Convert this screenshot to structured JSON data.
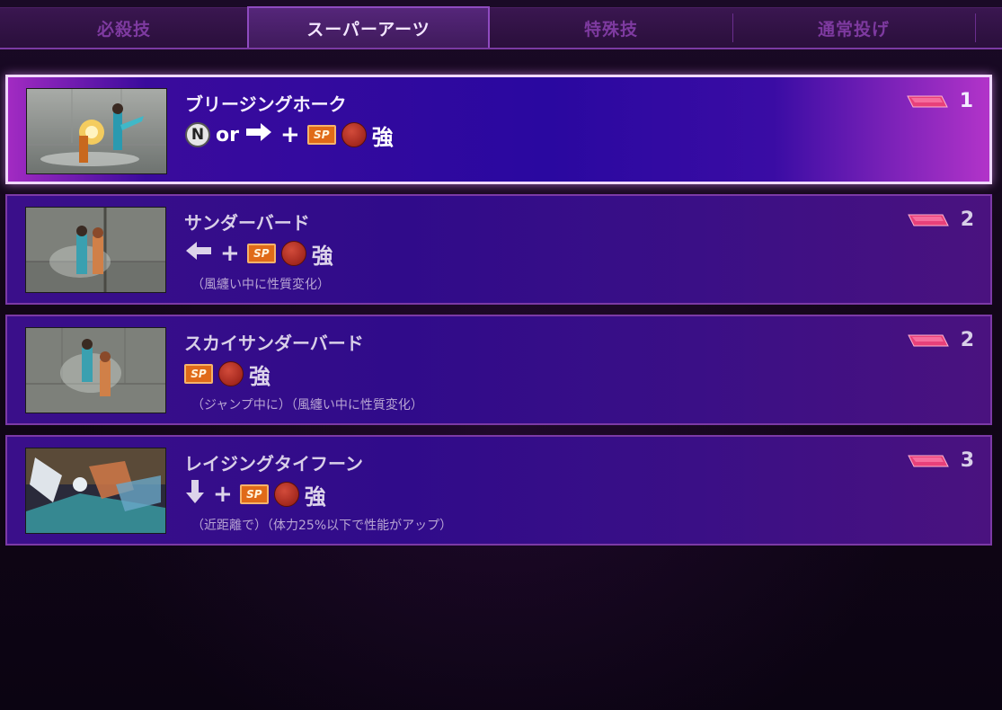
{
  "tabs": [
    {
      "label": "必殺技",
      "active": false
    },
    {
      "label": "スーパーアーツ",
      "active": true
    },
    {
      "label": "特殊技",
      "active": false
    },
    {
      "label": "通常投げ",
      "active": false
    }
  ],
  "moves": [
    {
      "name": "ブリージングホーク",
      "input": {
        "neutral": "N",
        "or": "or",
        "direction": "right-arrow-icon",
        "plus": "+",
        "sp": "SP",
        "button": "heavy-punch-icon",
        "strength": "強"
      },
      "note": "",
      "gauge_level": "1",
      "selected": true
    },
    {
      "name": "サンダーバード",
      "input": {
        "direction": "left-arrow-icon",
        "plus": "+",
        "sp": "SP",
        "button": "heavy-punch-icon",
        "strength": "強"
      },
      "note": "（風纏い中に性質変化）",
      "gauge_level": "2",
      "selected": false
    },
    {
      "name": "スカイサンダーバード",
      "input": {
        "sp": "SP",
        "button": "heavy-punch-icon",
        "strength": "強"
      },
      "note": "（ジャンプ中に）（風纏い中に性質変化）",
      "gauge_level": "2",
      "selected": false
    },
    {
      "name": "レイジングタイフーン",
      "input": {
        "direction": "down-arrow-icon",
        "plus": "+",
        "sp": "SP",
        "button": "heavy-punch-icon",
        "strength": "強"
      },
      "note": "（近距離で）（体力25%以下で性能がアップ）",
      "gauge_level": "3",
      "selected": false
    }
  ],
  "colors": {
    "accent": "#a22bc2",
    "row_bg": "#300b8a",
    "gauge": "#e8407a",
    "sp_badge": "#e06a18",
    "heavy_button": "#a4281e"
  }
}
